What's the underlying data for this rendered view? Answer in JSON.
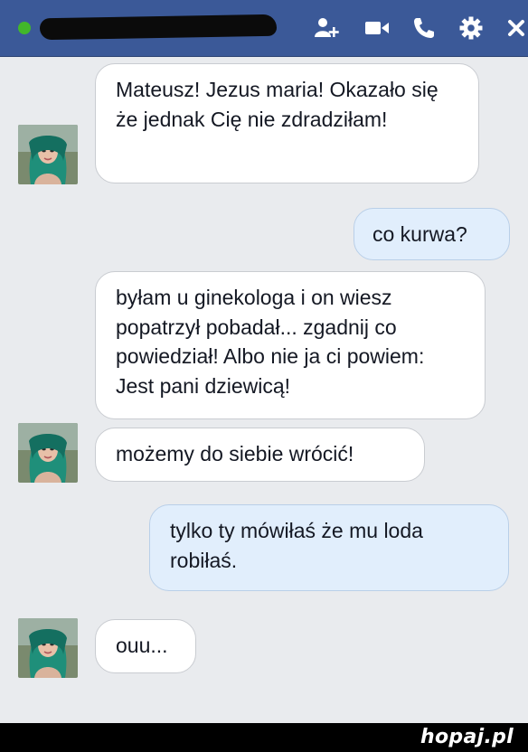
{
  "header": {
    "contact_name_redacted": true,
    "icons": [
      "add-person-icon",
      "video-call-icon",
      "phone-icon",
      "settings-gear-icon",
      "close-icon"
    ],
    "online_color": "#42b72a",
    "bar_color": "#3b5998"
  },
  "messages": [
    {
      "side": "in",
      "text": "Mateusz! Jezus maria! Okazało się że jednak Cię nie zdradziłam!"
    },
    {
      "side": "out",
      "text": "co kurwa?"
    },
    {
      "side": "in",
      "text": "byłam u ginekologa i on wiesz popatrzył pobadał... zgadnij co powiedział! Albo nie ja ci powiem: Jest pani dziewicą!"
    },
    {
      "side": "in",
      "text": "możemy do siebie wrócić!"
    },
    {
      "side": "out",
      "text": "tylko ty mówiłaś że mu loda robiłaś."
    },
    {
      "side": "in",
      "text": "ouu..."
    }
  ],
  "footer": {
    "watermark": "hopaj.pl"
  }
}
